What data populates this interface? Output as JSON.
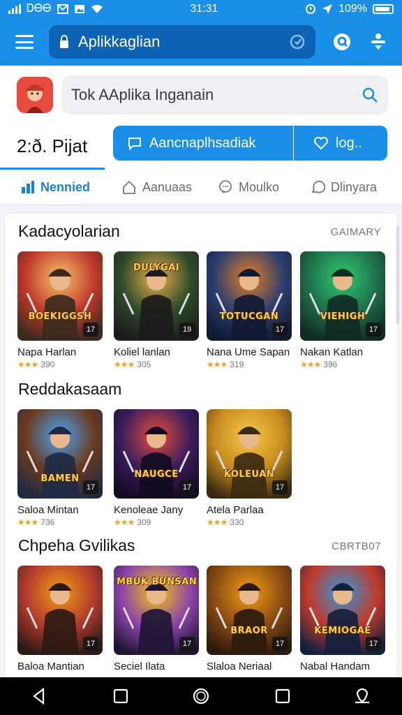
{
  "status_bar": {
    "left_text": "ᎠᎾᎾ",
    "time": "31:31",
    "battery": "109%"
  },
  "app_bar": {
    "url_text": "Aplikkaglian",
    "icons": [
      "menu-icon",
      "lock-icon",
      "reload-icon",
      "info-icon",
      "download-icon"
    ]
  },
  "header": {
    "search_text": "Tok AAplika Inganain",
    "rating_text": "2:ð. Pijat",
    "primary_button": "Aancnaplhsadiak",
    "secondary_button": "log..",
    "tabs": [
      {
        "label": "Nennied",
        "icon": "chart-icon"
      },
      {
        "label": "Aanuaas",
        "icon": "house-icon"
      },
      {
        "label": "Moulko",
        "icon": "chat-icon"
      },
      {
        "label": "Dlinyara",
        "icon": "bubble-icon"
      }
    ]
  },
  "sections": [
    {
      "title": "Kadacyolarian",
      "more": "GAIMARY",
      "items": [
        {
          "name": "Napa Harlan",
          "rating": "390",
          "age": "17",
          "banner": "BOEKIGGSH",
          "palette": [
            "#f5c46a",
            "#c0392b",
            "#3b2a1e"
          ]
        },
        {
          "name": "Koliel lanlan",
          "rating": "305",
          "age": "19",
          "banner": "DULYGAI",
          "palette": [
            "#e6b04a",
            "#2f4b2b",
            "#1b1b1b"
          ]
        },
        {
          "name": "Nana Ume Sapan",
          "rating": "319",
          "age": "17",
          "banner": "TOTUCGAN",
          "palette": [
            "#e67e22",
            "#2c3e70",
            "#101a33"
          ]
        },
        {
          "name": "Nakan Katlan",
          "rating": "396",
          "age": "17",
          "banner": "VIEHIGH",
          "palette": [
            "#2ecc71",
            "#1f6f4a",
            "#102a24"
          ]
        }
      ]
    },
    {
      "title": "Reddakasaam",
      "more": "",
      "items": [
        {
          "name": "Saloa Mintan",
          "rating": "736",
          "age": "17",
          "banner": "BAMEN",
          "palette": [
            "#4aa3f5",
            "#6b3a1f",
            "#1e2a44"
          ]
        },
        {
          "name": "Kenoleae Jany",
          "rating": "309",
          "age": "17",
          "banner": "NAUGCE",
          "palette": [
            "#e74c3c",
            "#3a1d5c",
            "#120b22"
          ]
        },
        {
          "name": "Atela Parlaa",
          "rating": "330",
          "age": "17",
          "banner": "KOLEUAN",
          "palette": [
            "#f6c94a",
            "#c98a1e",
            "#3b2a10"
          ]
        }
      ]
    },
    {
      "title": "Chpeha Gvilikas",
      "more": "CBRTB07",
      "items": [
        {
          "name": "Baloa Mantian",
          "rating": "",
          "age": "17",
          "banner": "",
          "palette": [
            "#f39c12",
            "#b03a2e",
            "#2b1a14"
          ]
        },
        {
          "name": "Seciel Ilata",
          "rating": "",
          "age": "17",
          "banner": "MBUK BUNSAN",
          "palette": [
            "#f1c40f",
            "#8e44ad",
            "#1f1533"
          ]
        },
        {
          "name": "Slaloa Neriaal",
          "rating": "",
          "age": "17",
          "banner": "BRAOR",
          "palette": [
            "#f39c12",
            "#8a4b12",
            "#2b1a0d"
          ]
        },
        {
          "name": "Nabal Handam",
          "rating": "",
          "age": "17",
          "banner": "KEMIOGAE",
          "palette": [
            "#3498db",
            "#c0392b",
            "#14213d"
          ]
        }
      ]
    }
  ],
  "colors": {
    "brand_blue": "#1a8fe8",
    "url_bar_blue": "#0f63b4",
    "star_gold": "#f0a21a"
  },
  "nav_bar": {
    "buttons": [
      "back-icon",
      "recents-icon",
      "home-icon",
      "overview-icon",
      "assistant-icon"
    ]
  }
}
